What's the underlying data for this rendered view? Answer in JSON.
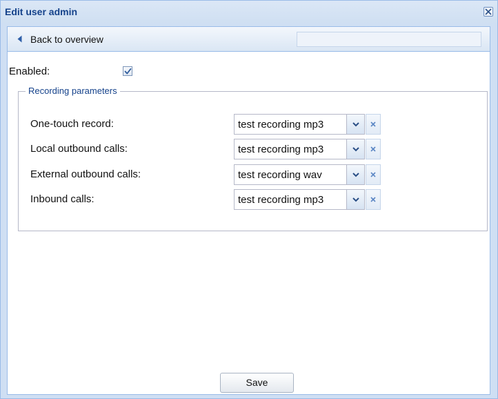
{
  "window": {
    "title": "Edit user admin"
  },
  "toolbar": {
    "back_label": "Back to overview",
    "back_icon": "triangle-left-icon"
  },
  "form": {
    "enabled_label": "Enabled:",
    "enabled_checked": true,
    "fieldset_legend": "Recording parameters",
    "rows": [
      {
        "label": "One-touch record:",
        "value": "test recording mp3"
      },
      {
        "label": "Local outbound calls:",
        "value": "test recording mp3"
      },
      {
        "label": "External outbound calls:",
        "value": "test recording wav"
      },
      {
        "label": "Inbound calls:",
        "value": "test recording mp3"
      }
    ]
  },
  "footer": {
    "save_label": "Save"
  },
  "colors": {
    "accent": "#15428b",
    "border": "#99bbe8",
    "frame_bg": "#cfdff3"
  }
}
